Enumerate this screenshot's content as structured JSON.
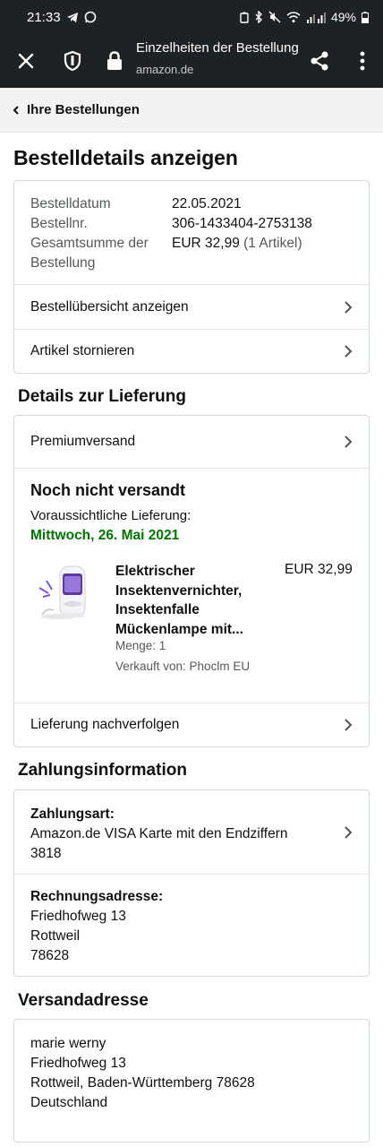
{
  "status_bar": {
    "time": "21:33",
    "battery": "49%"
  },
  "browser": {
    "title": "Einzelheiten der Bestellung",
    "url": "amazon.de"
  },
  "back_nav": {
    "label": "Ihre Bestellungen"
  },
  "page_title": "Bestelldetails anzeigen",
  "order_summary": {
    "date_label": "Bestelldatum",
    "date_value": "22.05.2021",
    "number_label": "Bestellnr.",
    "number_value": "306-1433404-2753138",
    "total_label_1": "Gesamtsumme der",
    "total_label_2": "Bestellung",
    "total_value": "EUR 32,99",
    "total_items": "(1 Artikel)",
    "overview_link": "Bestellübersicht anzeigen",
    "cancel_link": "Artikel stornieren"
  },
  "delivery": {
    "heading": "Details zur Lieferung",
    "shipping_type": "Premiumversand",
    "status": "Noch nicht versandt",
    "eta_label": "Voraussichtliche Lieferung:",
    "eta_date": "Mittwoch, 26. Mai 2021",
    "item": {
      "title_1": "Elektrischer",
      "title_2": "Insektenvernichter,",
      "title_3": "Insektenfalle",
      "title_4": "Mückenlampe mit...",
      "price": "EUR 32,99",
      "quantity": "Menge: 1",
      "seller": "Verkauft von: Phoclm EU"
    },
    "track_link": "Lieferung nachverfolgen"
  },
  "payment": {
    "heading": "Zahlungsinformation",
    "method_label": "Zahlungsart:",
    "method_line1": "Amazon.de VISA Karte mit den Endziffern",
    "method_line2": "3818",
    "billing_label": "Rechnungsadresse:",
    "billing_line1": "Friedhofweg 13",
    "billing_line2": "Rottweil",
    "billing_line3": "78628"
  },
  "shipping_address": {
    "heading": "Versandadresse",
    "line1": "marie werny",
    "line2": "Friedhofweg 13",
    "line3": "Rottweil, Baden-Württemberg 78628",
    "line4": "Deutschland"
  },
  "colors": {
    "eta_green": "#007600",
    "border": "#d5d9d9",
    "dark_bar": "#202124"
  }
}
